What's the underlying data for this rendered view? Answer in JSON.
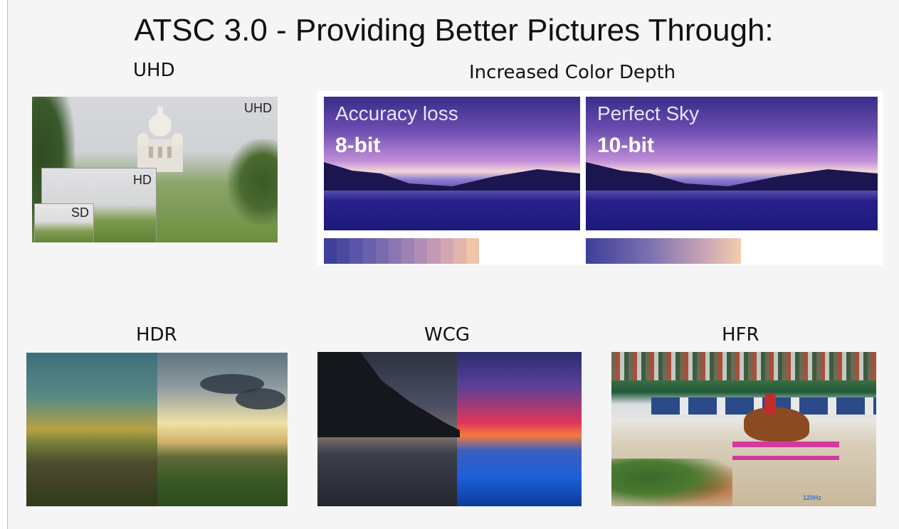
{
  "title": "ATSC 3.0 - Providing Better Pictures Through:",
  "sections": {
    "uhd": {
      "label": "UHD",
      "tags": {
        "uhd": "UHD",
        "hd": "HD",
        "sd": "SD"
      }
    },
    "color_depth": {
      "label": "Increased Color Depth",
      "left": {
        "caption": "Accuracy loss",
        "bits": "8-bit"
      },
      "right": {
        "caption": "Perfect Sky",
        "bits": "10-bit"
      },
      "bar_colors_8bit": [
        "#3e419a",
        "#4a4aa0",
        "#5a55a6",
        "#6a60ab",
        "#7a6aae",
        "#8c76b1",
        "#9e82b3",
        "#b08eb3",
        "#c29ab3",
        "#d3a7b0",
        "#e3b4ac",
        "#f1c3a8"
      ]
    },
    "hdr": {
      "label": "HDR"
    },
    "wcg": {
      "label": "WCG"
    },
    "hfr": {
      "label": "HFR",
      "frame_rate_tag": "120Hz"
    }
  }
}
